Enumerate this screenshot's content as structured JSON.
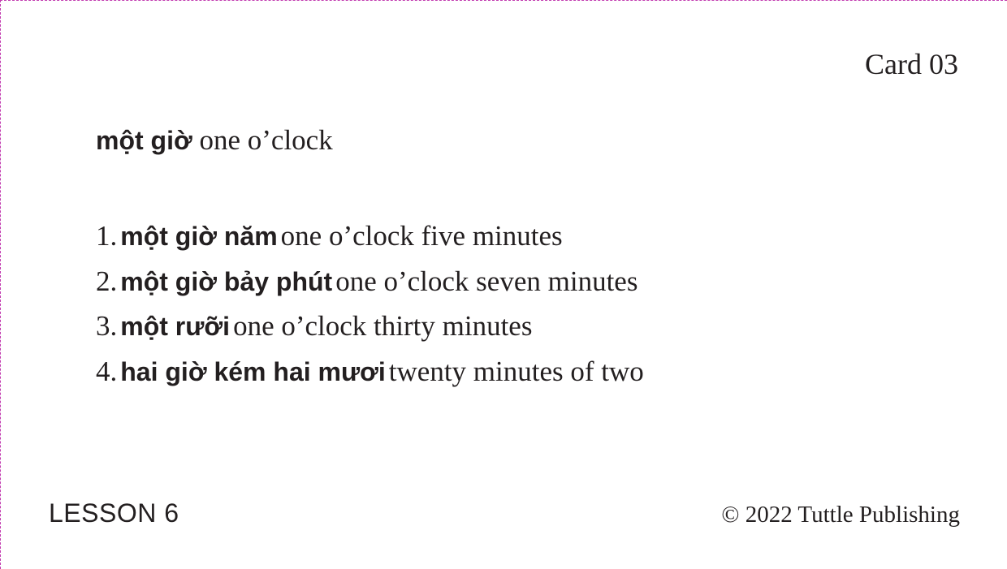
{
  "card": {
    "number_label": "Card 03",
    "headword": {
      "vietnamese": "một giờ",
      "english": "one o’clock"
    },
    "examples": [
      {
        "number": "1.",
        "vietnamese": "một giờ năm",
        "english": "one o’clock five minutes"
      },
      {
        "number": "2.",
        "vietnamese": "một giờ bảy phút",
        "english": "one o’clock seven minutes"
      },
      {
        "number": "3.",
        "vietnamese": "một rưỡi",
        "english": "one o’clock thirty minutes"
      },
      {
        "number": "4.",
        "vietnamese": "hai giờ kém hai mươi",
        "english": "twenty minutes of two"
      }
    ],
    "lesson_label": "LESSON 6",
    "copyright": "© 2022 Tuttle Publishing"
  },
  "colors": {
    "text": "#231f20",
    "trim_line": "#c23bb0",
    "background": "#ffffff"
  }
}
